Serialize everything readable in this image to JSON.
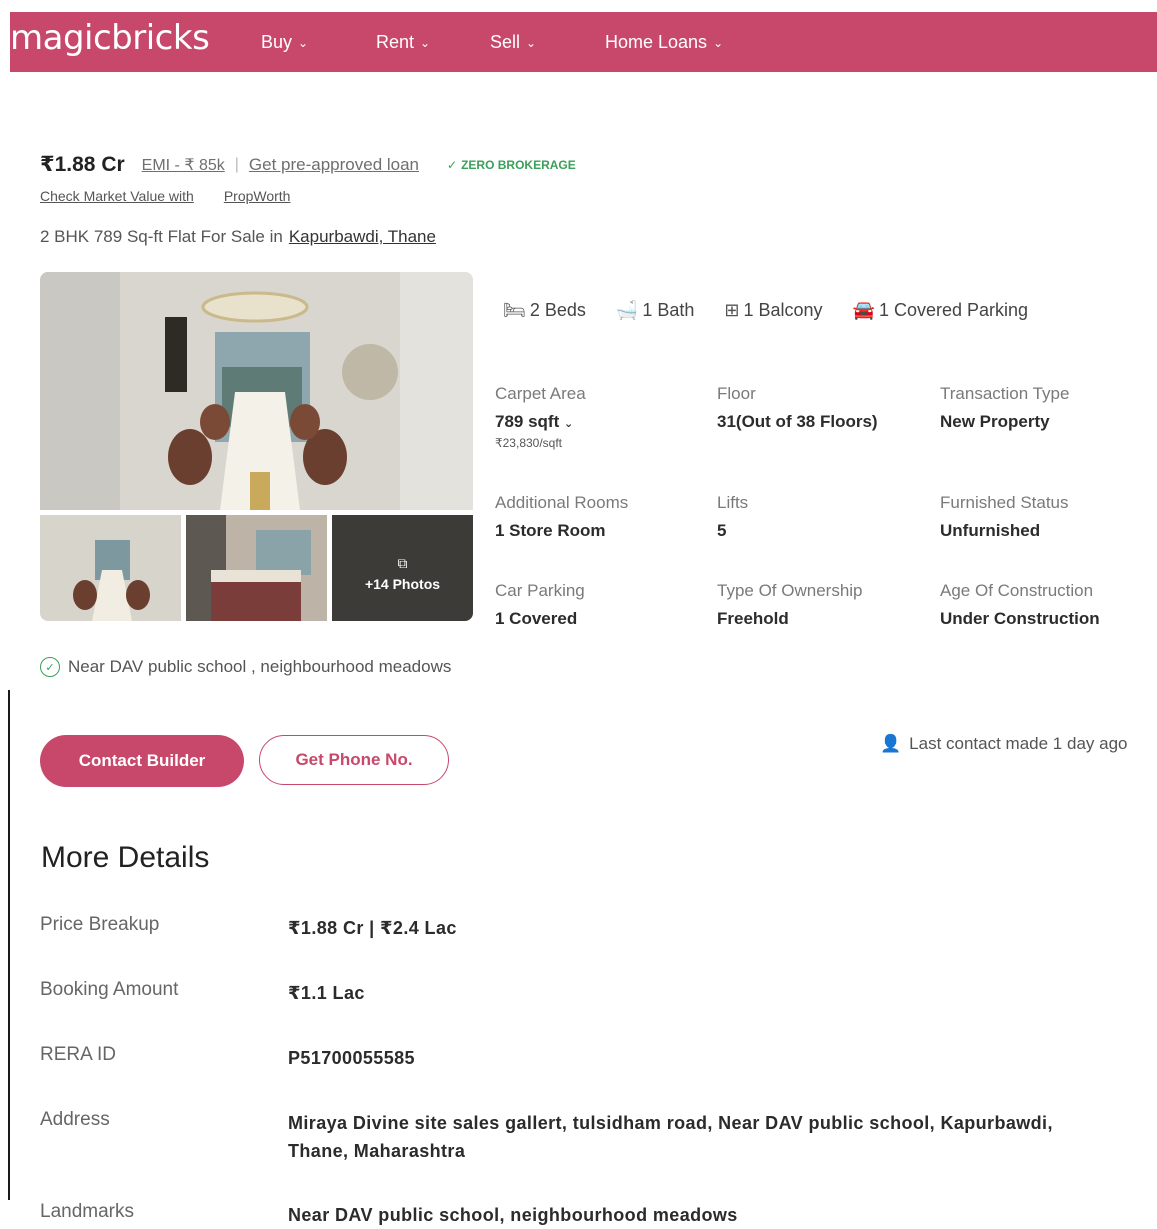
{
  "header": {
    "logo": "magicbricks",
    "nav": [
      {
        "label": "Buy"
      },
      {
        "label": "Rent"
      },
      {
        "label": "Sell"
      },
      {
        "label": "Home Loans"
      }
    ]
  },
  "listing": {
    "price": "₹1.88 Cr",
    "emi": "EMI - ₹ 85k",
    "preapproved": "Get pre-approved loan",
    "zero_brokerage": "ZERO BROKERAGE",
    "market_value_a": "Check Market Value with",
    "market_value_b": "PropWorth",
    "title": "2 BHK 789 Sq-ft Flat For Sale in",
    "locality": "Kapurbawdi, Thane",
    "photos_more": "+14 Photos"
  },
  "amenities": {
    "beds": "2 Beds",
    "bath": "1 Bath",
    "balcony": "1 Balcony",
    "parking": "1 Covered Parking"
  },
  "specs": {
    "carpet_area": {
      "label": "Carpet Area",
      "value": "789 sqft",
      "sub": "₹23,830/sqft"
    },
    "floor": {
      "label": "Floor",
      "value": "31(Out of 38 Floors)"
    },
    "transaction": {
      "label": "Transaction Type",
      "value": "New Property"
    },
    "additional_rooms": {
      "label": "Additional Rooms",
      "value": "1 Store Room"
    },
    "lifts": {
      "label": "Lifts",
      "value": "5"
    },
    "furnished": {
      "label": "Furnished Status",
      "value": "Unfurnished"
    },
    "car_parking": {
      "label": "Car Parking",
      "value": "1 Covered"
    },
    "ownership": {
      "label": "Type Of Ownership",
      "value": "Freehold"
    },
    "age": {
      "label": "Age Of Construction",
      "value": "Under Construction"
    }
  },
  "landmark_note": "Near DAV public school , neighbourhood meadows",
  "actions": {
    "contact": "Contact Builder",
    "phone": "Get Phone No.",
    "last_contact": "Last contact made 1 day ago"
  },
  "more_details": {
    "title": "More Details",
    "rows": [
      {
        "label": "Price Breakup",
        "value": "₹1.88 Cr | ₹2.4 Lac"
      },
      {
        "label": "Booking Amount",
        "value": "₹1.1 Lac"
      },
      {
        "label": "RERA ID",
        "value": "P51700055585"
      },
      {
        "label": "Address",
        "value": "Miraya Divine site sales gallert, tulsidham road, Near DAV public school, Kapurbawdi, Thane, Maharashtra"
      },
      {
        "label": "Landmarks",
        "value": "Near DAV public school, neighbourhood meadows"
      }
    ]
  },
  "colors": {
    "brand": "#c7486b",
    "positive": "#3aa05a"
  }
}
